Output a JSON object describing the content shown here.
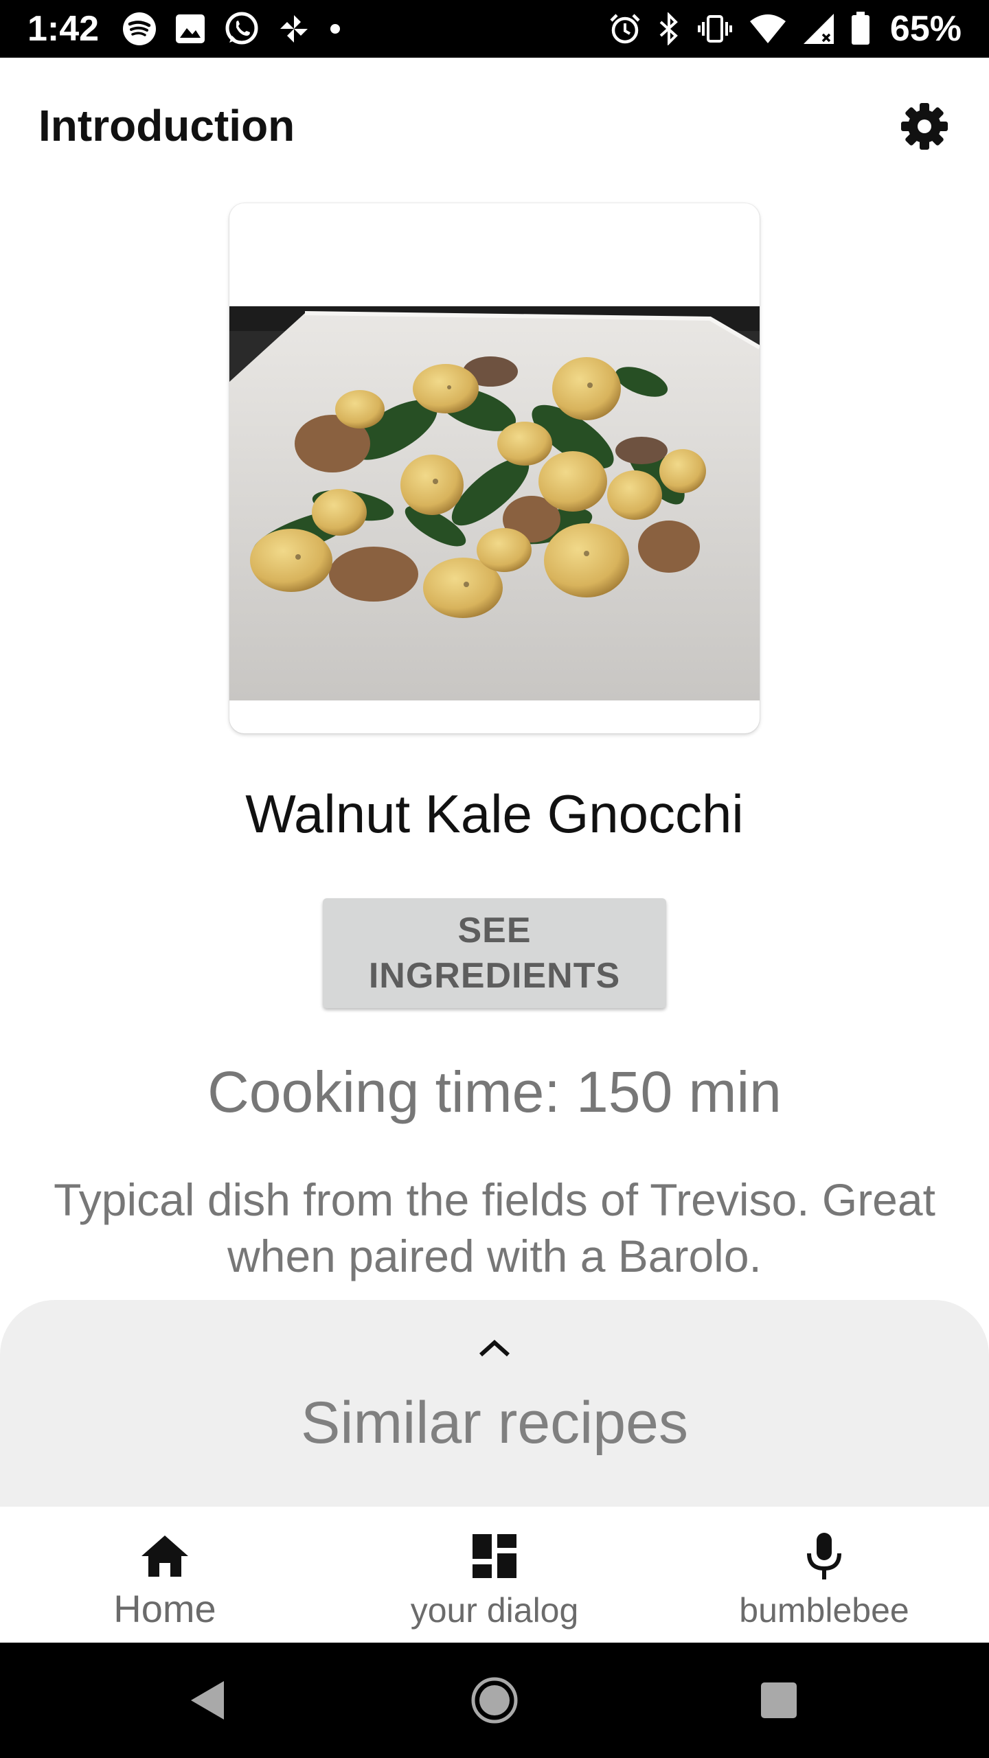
{
  "status_bar": {
    "time": "1:42",
    "battery_percent": "65%",
    "left_icons": [
      "spotify-icon",
      "gallery-icon",
      "whatsapp-icon",
      "pinwheel-icon",
      "dot-icon"
    ],
    "right_icons": [
      "alarm-icon",
      "bluetooth-icon",
      "vibrate-icon",
      "wifi-icon",
      "signal-icon",
      "battery-icon"
    ]
  },
  "app_bar": {
    "title": "Introduction",
    "settings_icon": "gear-icon"
  },
  "recipe": {
    "name": "Walnut Kale Gnocchi",
    "ingredients_button": "SEE INGREDIENTS",
    "cooking_time": "Cooking time: 150 min",
    "description": "Typical dish from the fields of Treviso. Great when paired with a Barolo."
  },
  "similar_sheet": {
    "title": "Similar recipes",
    "toggle_icon": "chevron-up-icon"
  },
  "bottom_nav": {
    "items": [
      {
        "label": "Home",
        "icon": "home-icon",
        "active": true
      },
      {
        "label": "your dialog",
        "icon": "dashboard-icon",
        "active": false
      },
      {
        "label": "bumblebee",
        "icon": "microphone-icon",
        "active": false
      }
    ]
  },
  "system_nav": [
    "back-icon",
    "home-circle-icon",
    "recents-icon"
  ],
  "colors": {
    "status_bar": "#000000",
    "button_bg": "#d6d7d7",
    "secondary_text": "#777777",
    "sheet_bg": "#efefef"
  }
}
